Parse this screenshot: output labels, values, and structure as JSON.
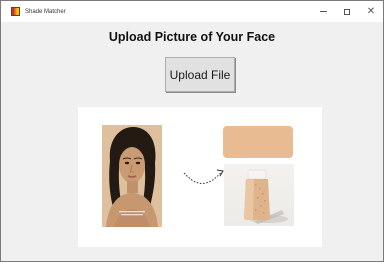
{
  "window": {
    "title": "Shade Matcher",
    "controls": {
      "minimize_icon": "minimize-icon",
      "maximize_icon": "maximize-icon",
      "close_icon": "close-icon"
    }
  },
  "main": {
    "heading": "Upload Picture of Your Face",
    "upload_button_label": "Upload File"
  },
  "preview": {
    "photo": "face-photo",
    "arrow": "dotted-arrow",
    "swatch_color": "#E8BB93",
    "product": "foundation-bottle-image"
  },
  "colors": {
    "window_bg": "#F0F0F0",
    "panel_bg": "#FFFFFF",
    "button_bg": "#E1E1E1"
  }
}
